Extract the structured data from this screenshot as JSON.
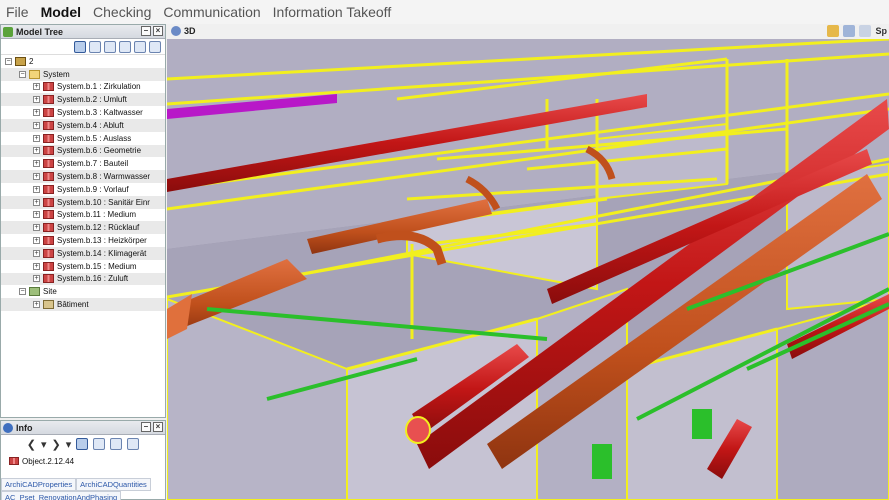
{
  "menu": [
    "File",
    "Model",
    "Checking",
    "Communication",
    "Information Takeoff"
  ],
  "tree": {
    "title": "Model Tree",
    "rows": [
      {
        "label": "2",
        "indent": 0,
        "icon": "house"
      },
      {
        "label": "System",
        "indent": 1,
        "icon": "folder"
      },
      {
        "label": "System.b.1 : Zirkulation",
        "indent": 2,
        "icon": "pipe"
      },
      {
        "label": "System.b.2 : Umluft",
        "indent": 2,
        "icon": "pipe"
      },
      {
        "label": "System.b.3 : Kaltwasser",
        "indent": 2,
        "icon": "pipe"
      },
      {
        "label": "System.b.4 : Abluft",
        "indent": 2,
        "icon": "pipe"
      },
      {
        "label": "System.b.5 : Auslass",
        "indent": 2,
        "icon": "pipe"
      },
      {
        "label": "System.b.6 : Geometrie",
        "indent": 2,
        "icon": "pipe"
      },
      {
        "label": "System.b.7 : Bauteil",
        "indent": 2,
        "icon": "pipe"
      },
      {
        "label": "System.b.8 : Warmwasser",
        "indent": 2,
        "icon": "pipe"
      },
      {
        "label": "System.b.9 : Vorlauf",
        "indent": 2,
        "icon": "pipe"
      },
      {
        "label": "System.b.10 : Sanitär Einr",
        "indent": 2,
        "icon": "pipe"
      },
      {
        "label": "System.b.11 : Medium",
        "indent": 2,
        "icon": "pipe"
      },
      {
        "label": "System.b.12 : Rücklauf",
        "indent": 2,
        "icon": "pipe"
      },
      {
        "label": "System.b.13 : Heizkörper",
        "indent": 2,
        "icon": "pipe"
      },
      {
        "label": "System.b.14 : Klimagerät",
        "indent": 2,
        "icon": "pipe"
      },
      {
        "label": "System.b.15 : Medium",
        "indent": 2,
        "icon": "pipe"
      },
      {
        "label": "System.b.16 : Zuluft",
        "indent": 2,
        "icon": "pipe"
      },
      {
        "label": "Site",
        "indent": 1,
        "icon": "site"
      },
      {
        "label": "Bâtiment",
        "indent": 2,
        "icon": "bldg"
      }
    ]
  },
  "info": {
    "title": "Info",
    "object": "Object.2.12.44",
    "tabs": [
      "ArchiCADProperties",
      "ArchiCADQuantities",
      "AC_Pset_RenovationAndPhasing"
    ]
  },
  "view3d": {
    "title": "3D",
    "tool_label": "Sp"
  },
  "colors": {
    "pipe_red": "#cc1f1f",
    "duct_orange": "#c8561e",
    "outline_yellow": "#f2ef1e",
    "pipe_green": "#2bbf2b",
    "pipe_magenta": "#b818c8",
    "wall_lavender": "#b9b6c8"
  }
}
